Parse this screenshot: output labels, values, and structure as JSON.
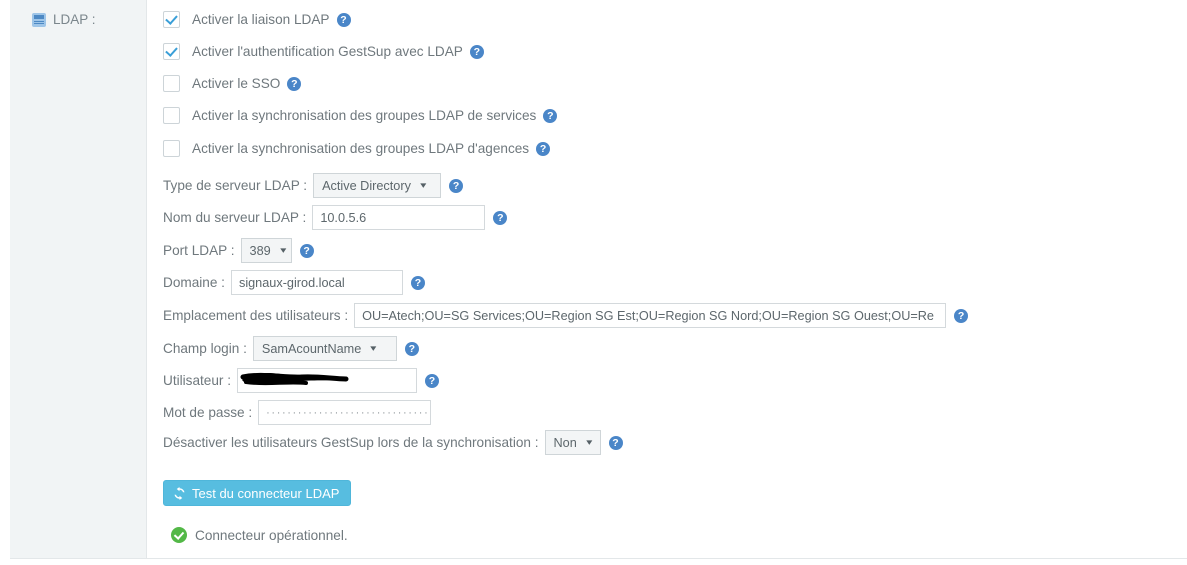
{
  "section": {
    "label": "LDAP :",
    "icon": "list-alt-icon"
  },
  "checkboxes": [
    {
      "label": "Activer la liaison LDAP",
      "checked": true,
      "help": "?"
    },
    {
      "label": "Activer l'authentification GestSup avec LDAP",
      "checked": true,
      "help": "?"
    },
    {
      "label": "Activer le SSO",
      "checked": false,
      "help": "?"
    },
    {
      "label": "Activer la synchronisation des groupes LDAP de services",
      "checked": false,
      "help": "?"
    },
    {
      "label": "Activer la synchronisation des groupes LDAP d'agences",
      "checked": false,
      "help": "?"
    }
  ],
  "fields": {
    "server_type": {
      "label": "Type de serveur LDAP :",
      "value": "Active Directory",
      "caret": "▾",
      "help": "?"
    },
    "server_name": {
      "label": "Nom du serveur LDAP :",
      "value": "10.0.5.6",
      "help": "?"
    },
    "port": {
      "label": "Port LDAP :",
      "value": "389",
      "caret": "▾",
      "help": "?"
    },
    "domain": {
      "label": "Domaine :",
      "value": "signaux-girod.local",
      "help": "?"
    },
    "users_location": {
      "label": "Emplacement des utilisateurs :",
      "value": "OU=Atech;OU=SG Services;OU=Region SG Est;OU=Region SG Nord;OU=Region SG Ouest;OU=Re",
      "help": "?"
    },
    "login_field": {
      "label": "Champ login :",
      "value": "SamAcountName",
      "caret": "▾",
      "help": "?"
    },
    "user": {
      "label": "Utilisateur :",
      "value": "",
      "redacted": true,
      "help": "?"
    },
    "password": {
      "label": "Mot de passe :",
      "value": "································",
      "help": ""
    },
    "disable_users": {
      "label": "Désactiver les utilisateurs GestSup lors de la synchronisation :",
      "value": "Non",
      "caret": "▾",
      "help": "?"
    }
  },
  "test_button": {
    "label": "Test du connecteur LDAP",
    "icon": "refresh-icon"
  },
  "status": {
    "icon": "check-circle-icon",
    "text": "Connecteur opérationnel."
  },
  "colors": {
    "panel_bg": "#f1f4f5",
    "accent_blue": "#4a86c8",
    "checkbox_check": "#3a9fd8",
    "button_blue": "#57bde0",
    "success_green": "#53b847",
    "text": "#6f787d"
  }
}
